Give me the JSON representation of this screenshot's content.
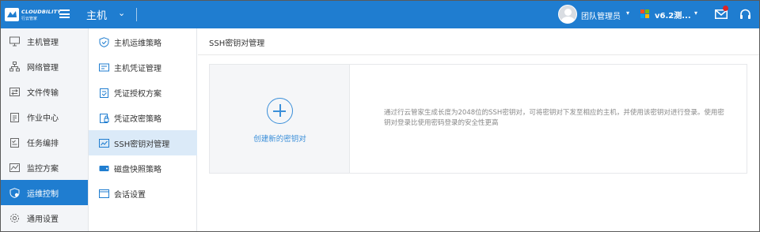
{
  "topbar": {
    "brand": "CLOUDBILITY",
    "brand_sub": "行云管家",
    "module": "主机",
    "user_name": "团队管理员",
    "version": "v6.2测...",
    "brand_color": "#1f7dd0"
  },
  "sidebar": {
    "items": [
      {
        "label": "主机管理",
        "icon": "monitor-icon"
      },
      {
        "label": "网络管理",
        "icon": "network-icon"
      },
      {
        "label": "文件传输",
        "icon": "file-transfer-icon"
      },
      {
        "label": "作业中心",
        "icon": "clipboard-icon"
      },
      {
        "label": "任务编排",
        "icon": "task-icon"
      },
      {
        "label": "监控方案",
        "icon": "chart-icon"
      },
      {
        "label": "运维控制",
        "icon": "shield-icon",
        "active": true
      },
      {
        "label": "通用设置",
        "icon": "gear-icon"
      }
    ]
  },
  "submenu": {
    "items": [
      {
        "label": "主机运维策略",
        "icon": "shield-check-icon"
      },
      {
        "label": "主机凭证管理",
        "icon": "credential-icon"
      },
      {
        "label": "凭证授权方案",
        "icon": "authorize-icon"
      },
      {
        "label": "凭证改密策略",
        "icon": "lock-icon"
      },
      {
        "label": "SSH密钥对管理",
        "icon": "key-chart-icon",
        "active": true
      },
      {
        "label": "磁盘快照策略",
        "icon": "disk-icon"
      },
      {
        "label": "会话设置",
        "icon": "window-icon"
      }
    ]
  },
  "main": {
    "title": "SSH密钥对管理",
    "create_label": "创建新的密钥对",
    "description": "通过行云管家生成长度为2048位的SSH密钥对，可将密钥对下发至相应的主机，并使用该密钥对进行登录。使用密钥对登录比使用密码登录的安全性更高"
  }
}
